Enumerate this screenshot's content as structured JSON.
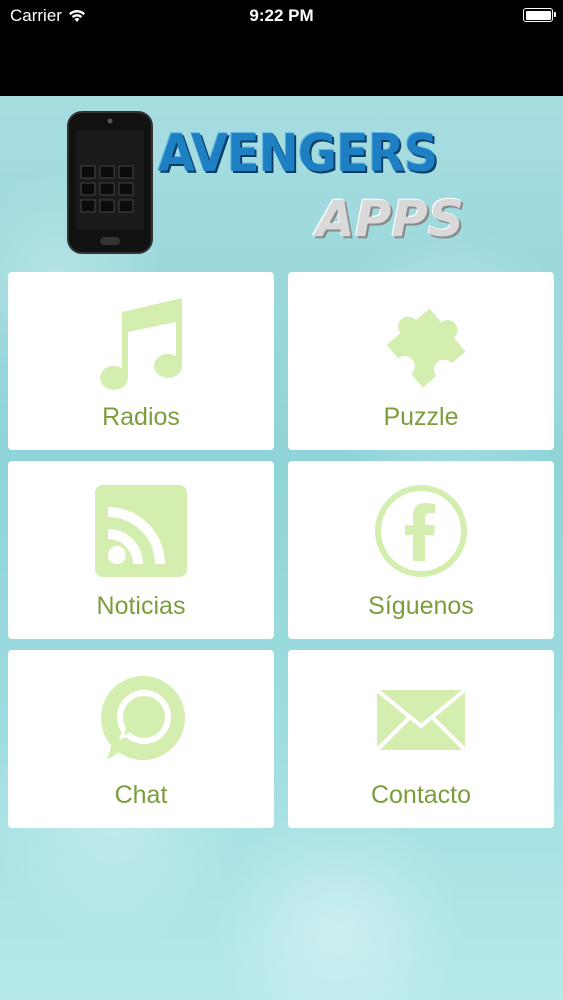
{
  "status_bar": {
    "carrier": "Carrier",
    "time": "9:22 PM"
  },
  "logo": {
    "brand": "AVENGERS",
    "sub": "APPS"
  },
  "colors": {
    "tile_icon": "#d3eeae",
    "tile_label": "#7a9e3c",
    "brand_blue": "#1e7fc2"
  },
  "menu": {
    "radios": "Radios",
    "puzzle": "Puzzle",
    "noticias": "Noticias",
    "siguenos": "Síguenos",
    "chat": "Chat",
    "contacto": "Contacto"
  }
}
